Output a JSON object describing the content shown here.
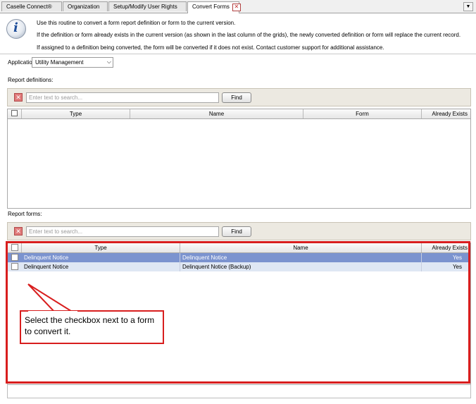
{
  "tabs": [
    {
      "label": "Caselle Connect®"
    },
    {
      "label": "Organization"
    },
    {
      "label": "Setup/Modify User Rights"
    },
    {
      "label": "Convert Forms",
      "active": true
    }
  ],
  "tab_close_glyph": "✕",
  "overflow_glyph": "▼",
  "info": {
    "icon": "info-icon",
    "glyph": "i",
    "lines": [
      "Use this routine to convert a form report definition or form to the current version.",
      "If the definition or form already exists in the current version (as shown in the last column of the grids), the newly converted definition or form will replace the current record.",
      "If assigned to a definition being converted, the form will be converted if it does not exist. Contact customer support for additional assistance."
    ]
  },
  "application": {
    "label": "Application:",
    "value": "Utility Management",
    "arrow": "⌵"
  },
  "report_definitions": {
    "label": "Report definitions:",
    "search_placeholder": "Enter text to search...",
    "find_label": "Find",
    "clear_glyph": "✕",
    "columns": [
      "Type",
      "Name",
      "Form",
      "Already Exists"
    ]
  },
  "report_forms": {
    "label": "Report forms:",
    "search_placeholder": "Enter text to search...",
    "find_label": "Find",
    "clear_glyph": "✕",
    "columns": [
      "Type",
      "Name",
      "Already Exists"
    ],
    "rows": [
      {
        "type": "Delinquent Notice",
        "name": "Delinquent Notice",
        "exists": "Yes"
      },
      {
        "type": "Delinquent Notice",
        "name": "Delinquent Notice (Backup)",
        "exists": "Yes"
      }
    ]
  },
  "annotation": {
    "text": "Select the checkbox next to a form to convert it.",
    "color": "#d81e1e"
  },
  "colors": {
    "selected_row": "#7b93cf",
    "alt_row": "#dfe7f4",
    "panel": "#ece9e1"
  }
}
